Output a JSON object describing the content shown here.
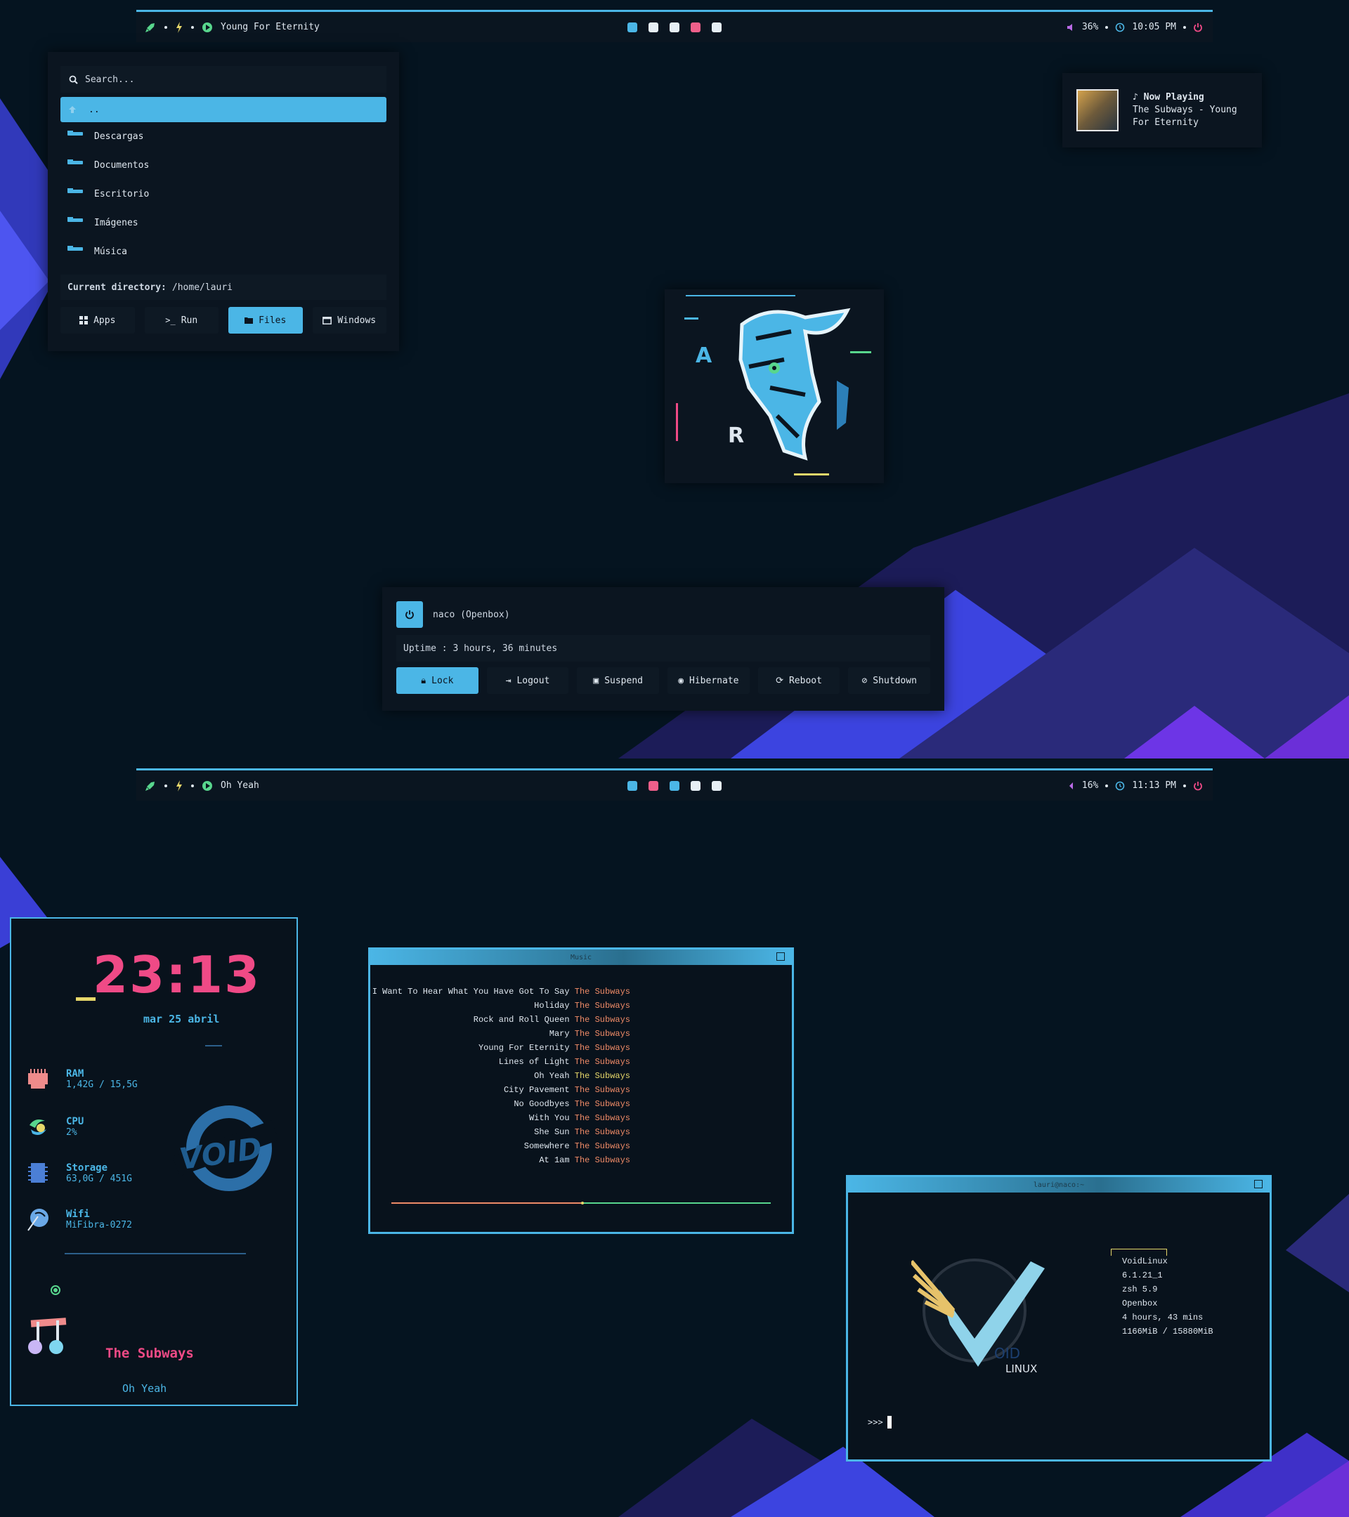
{
  "colors": {
    "accent": "#4bb6e6",
    "pink": "#ef4a86",
    "orange": "#ef8b67",
    "green": "#58d68d",
    "yellow": "#e6d76a",
    "panel": "#0b1520",
    "bg": "#051420"
  },
  "top": {
    "bar": {
      "now_playing": "Young For Eternity",
      "volume": "36%",
      "time": "10:05 PM",
      "workspaces": [
        "#4bb6e6",
        "#e6eef5",
        "#e6eef5",
        "#ef5f8a",
        "#e6eef5"
      ]
    },
    "launcher": {
      "search_placeholder": "Search...",
      "entries": [
        "..",
        "Descargas",
        "Documentos",
        "Escritorio",
        "Imágenes",
        "Música"
      ],
      "current_dir_label": "Current directory:",
      "current_dir": "/home/lauri",
      "modes": [
        "Apps",
        "Run",
        "Files",
        "Windows"
      ]
    },
    "now_playing": {
      "heading": "Now Playing",
      "line1": "The Subways - Young",
      "line2": "For Eternity"
    },
    "art_letters": [
      "A",
      "R"
    ],
    "power": {
      "user": "naco (Openbox)",
      "uptime": "Uptime : 3 hours, 36 minutes",
      "buttons": [
        "Lock",
        "Logout",
        "Suspend",
        "Hibernate",
        "Reboot",
        "Shutdown"
      ]
    }
  },
  "bottom": {
    "bar": {
      "now_playing": "Oh Yeah",
      "volume": "16%",
      "time": "11:13 PM",
      "workspaces": [
        "#4bb6e6",
        "#ef5f8a",
        "#4bb6e6",
        "#e6eef5",
        "#e6eef5"
      ]
    },
    "conky": {
      "clock": "23:13",
      "date": "mar 25 abril",
      "ram_label": "RAM",
      "ram_value": "1,42G / 15,5G",
      "cpu_label": "CPU",
      "cpu_value": "2%",
      "storage_label": "Storage",
      "storage_value": "63,0G / 451G",
      "wifi_label": "Wifi",
      "wifi_value": "MiFibra-0272",
      "logo_text": "VOID",
      "artist": "The Subways",
      "song": "Oh Yeah"
    },
    "music_window": {
      "title": "Music",
      "artist": "The Subways",
      "tracks": [
        "I Want To Hear What You Have Got To Say",
        "Holiday",
        "Rock and Roll Queen",
        "Mary",
        "Young For Eternity",
        "Lines of Light",
        "Oh Yeah",
        "City Pavement",
        "No Goodbyes",
        "With You",
        "She Sun",
        "Somewhere",
        "At 1am"
      ],
      "current_index": 6,
      "progress": 0.5
    },
    "terminal": {
      "title": "lauri@naco:~",
      "logo_text1": "OID",
      "logo_text2": "LINUX",
      "info": [
        "VoidLinux",
        "6.1.21_1",
        "zsh 5.9",
        "Openbox",
        "4 hours, 43 mins",
        "1166MiB / 15880MiB"
      ],
      "prompt": ">>>"
    }
  }
}
